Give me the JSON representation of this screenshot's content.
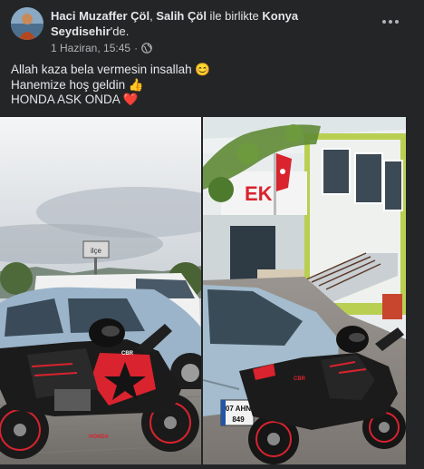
{
  "post": {
    "author": "Haci Muzaffer Çöl",
    "separator": ", ",
    "tagged": "Salih Çöl",
    "with_text": " ile birlikte ",
    "place": "Konya Seydisehir",
    "place_suffix": "'de.",
    "date": "1 Haziran, 15:45",
    "date_dot": "·",
    "text_lines": [
      "Allah kaza bela vermesin insallah 😊",
      "Hanemize hoş geldin 👍",
      "HONDA ASK ONDA ❤️"
    ]
  },
  "icons": {
    "avatar": "avatar",
    "more": "more-options-icon",
    "privacy": "globe-icon"
  },
  "photos": {
    "left_sign": "ilçe",
    "left_bike_brand": "HONDA",
    "left_bike_model": "CBR",
    "right_plate_line1": "07 AHN",
    "right_plate_line2": "849",
    "right_building_sign": "EK",
    "right_bike_model": "CBR"
  },
  "colors": {
    "background": "#18191a",
    "card": "#242526",
    "text_primary": "#e4e6eb",
    "text_secondary": "#b0b3b8",
    "accent_red": "#d9232e"
  }
}
